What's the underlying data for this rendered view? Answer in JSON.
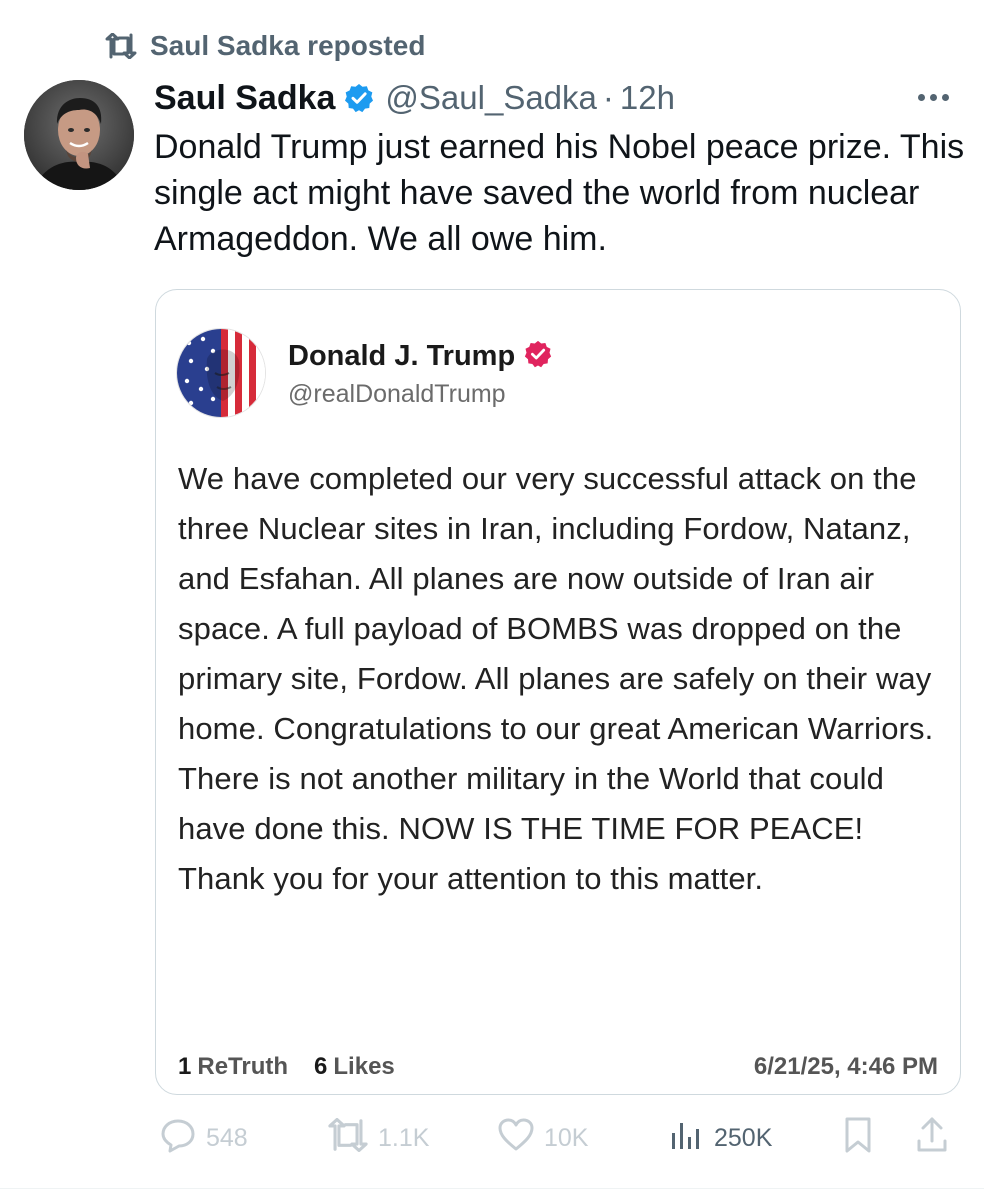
{
  "repost": {
    "icon": "repost-icon",
    "label": "Saul Sadka reposted"
  },
  "tweet": {
    "author_name": "Saul Sadka",
    "verified_color": "#1d9bf0",
    "handle": "@Saul_Sadka",
    "separator": "·",
    "time": "12h",
    "text": "Donald Trump just earned his Nobel peace prize. This single act might have saved the world from nuclear Armageddon. We all owe him."
  },
  "quote": {
    "name": "Donald J. Trump",
    "verified_color": "#e0245e",
    "handle": "@realDonaldTrump",
    "body": "We have completed our very successful attack on the three Nuclear sites in Iran, including Fordow, Natanz, and Esfahan. All planes are now outside of Iran air space. A full payload of BOMBS was dropped on the primary site, Fordow. All planes are safely on their way home. Congratulations to our great American Warriors. There is not another military in the World that could have done this. NOW IS THE TIME FOR PEACE! Thank you for your attention to this matter.",
    "retruth_count": "1",
    "retruth_label": "ReTruth",
    "likes_count": "6",
    "likes_label": "Likes",
    "date": "6/21/25, 4:46 PM"
  },
  "actions": {
    "reply_count": "548",
    "repost_count": "1.1K",
    "like_count": "10K",
    "views_count": "250K"
  },
  "colors": {
    "muted": "#536471",
    "faded": "#c5cdd3",
    "border": "#cfd9de"
  }
}
